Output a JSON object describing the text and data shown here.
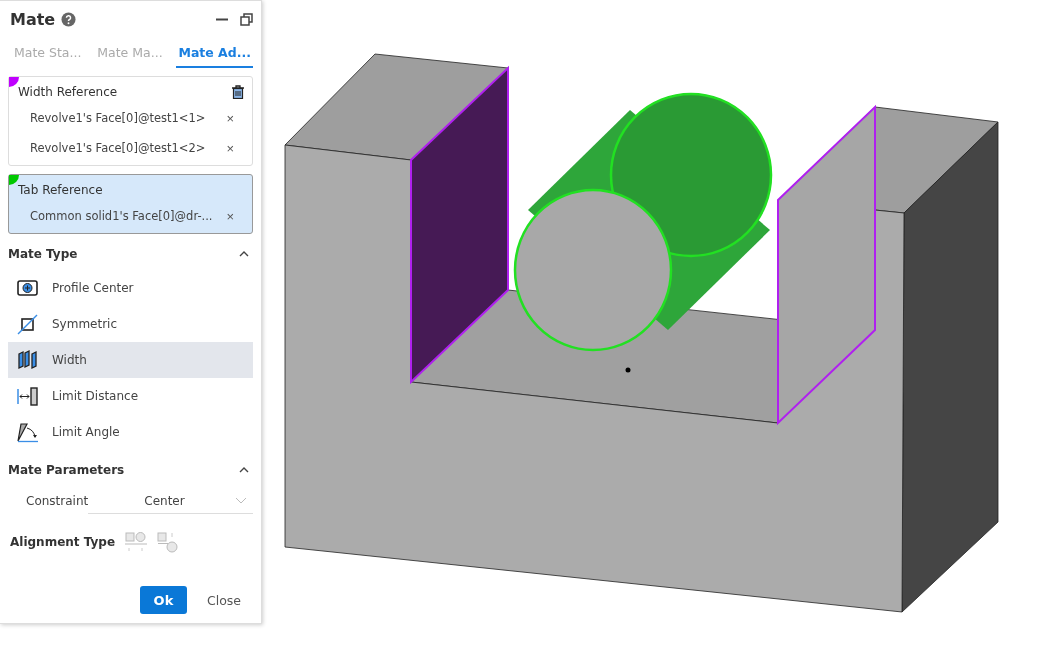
{
  "panel": {
    "title": "Mate"
  },
  "tabs": [
    {
      "label": "Mate Sta...",
      "selected": false
    },
    {
      "label": "Mate Ma...",
      "selected": false
    },
    {
      "label": "Mate Ad...",
      "selected": true
    }
  ],
  "references": [
    {
      "title": "Width Reference",
      "color": "#c000ff",
      "selected": false,
      "deletable": true,
      "items": [
        {
          "text": "Revolve1's Face[0]@test1<1>",
          "remove": "×"
        },
        {
          "text": "Revolve1's Face[0]@test1<2>",
          "remove": "×"
        }
      ]
    },
    {
      "title": "Tab Reference",
      "color": "#00c800",
      "selected": true,
      "deletable": false,
      "items": [
        {
          "text": "Common solid1's Face[0]@dr-...",
          "remove": "×"
        }
      ]
    }
  ],
  "mate_type": {
    "title": "Mate Type",
    "expanded": true,
    "items": [
      {
        "kind": "profile",
        "label": "Profile Center",
        "selected": false
      },
      {
        "kind": "symmetric",
        "label": "Symmetric",
        "selected": false
      },
      {
        "kind": "width",
        "label": "Width",
        "selected": true
      },
      {
        "kind": "distance",
        "label": "Limit Distance",
        "selected": false
      },
      {
        "kind": "angle",
        "label": "Limit Angle",
        "selected": false
      }
    ]
  },
  "mate_parameters": {
    "title": "Mate Parameters",
    "expanded": true,
    "constraint_label": "Constraint",
    "constraint_value": "Center"
  },
  "alignment": {
    "label": "Alignment Type"
  },
  "buttons": {
    "ok": "Ok",
    "close": "Close"
  }
}
